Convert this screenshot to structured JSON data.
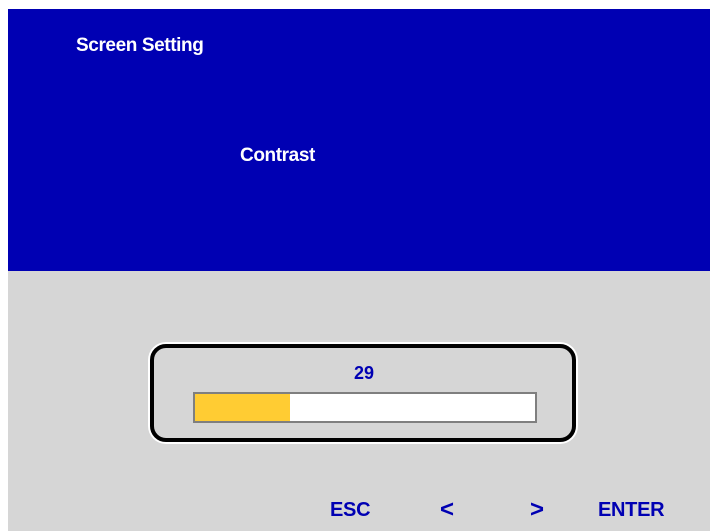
{
  "osd": {
    "menu_title": "Screen Setting",
    "item_title": "Contrast"
  },
  "slider": {
    "value_label": "29",
    "fill_fraction": 0.28,
    "fill_color": "#ffcc33",
    "track_color": "#ffffff"
  },
  "footer": {
    "esc_label": "ESC",
    "left_label": "<",
    "right_label": ">",
    "enter_label": "ENTER"
  },
  "colors": {
    "header_bg": "#0000b3",
    "body_bg": "#d6d6d6",
    "accent_text": "#0000b3"
  }
}
